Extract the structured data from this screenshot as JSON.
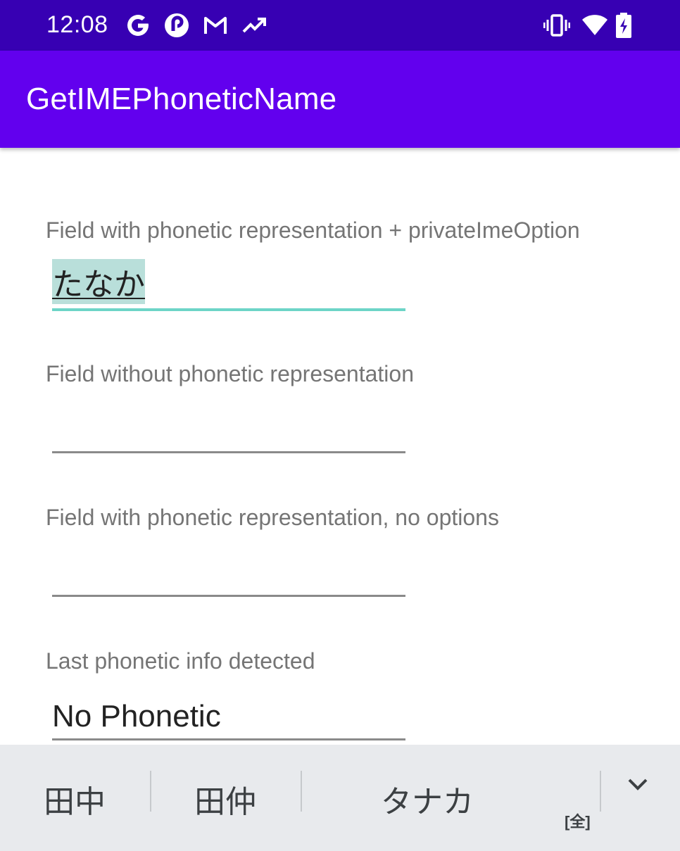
{
  "status_bar": {
    "time": "12:08",
    "left_icons": [
      "google-g-icon",
      "pocket-casts-icon",
      "gmail-icon",
      "trending-icon"
    ],
    "right_icons": [
      "vibrate-icon",
      "wifi-icon",
      "battery-charging-icon"
    ]
  },
  "app_bar": {
    "title": "GetIMEPhoneticName"
  },
  "form": {
    "field1": {
      "label": "Field with phonetic representation + privateImeOption",
      "value": "たなか"
    },
    "field2": {
      "label": "Field without phonetic representation",
      "value": ""
    },
    "field3": {
      "label": "Field with phonetic representation, no options",
      "value": ""
    },
    "field4": {
      "label": "Last phonetic info detected",
      "value": "No Phonetic"
    }
  },
  "ime_suggestions": {
    "candidates": [
      "田中",
      "田仲",
      "タナカ"
    ],
    "fullwidth_badge": "[全]",
    "expand_icon": "chevron-down-icon"
  },
  "colors": {
    "status_bar": "#3700b3",
    "app_bar": "#6200ee",
    "focused_underline": "#6dd5c7",
    "composing_highlight": "#b9dfda",
    "suggestion_bar": "#e8eaed"
  }
}
